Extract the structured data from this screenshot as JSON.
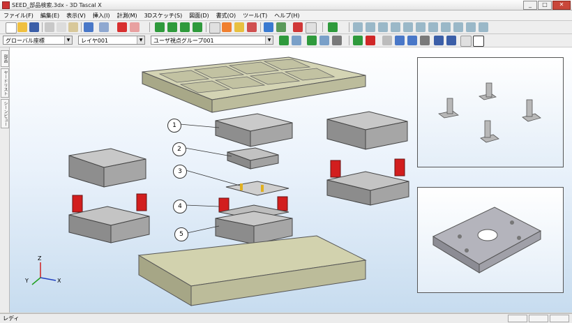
{
  "window": {
    "title": "SEED_部品検索.3dx - 3D Tascal X"
  },
  "menu": [
    "ファイル(F)",
    "編集(E)",
    "表示(V)",
    "挿入(I)",
    "計測(M)",
    "3Dスケッチ(S)",
    "図面(D)",
    "書式(O)",
    "ツール(T)",
    "ヘルプ(H)"
  ],
  "combos": {
    "coordinate": "グローバル座標",
    "layer": "レイヤ001",
    "group": "ユーザ視点グループ001"
  },
  "side_tabs": [
    "部品",
    "ヤードリスト",
    "シーンビュー"
  ],
  "callouts": [
    "1",
    "2",
    "3",
    "4",
    "5"
  ],
  "axes": {
    "z": "Z",
    "y": "Y",
    "x": "X"
  },
  "status": {
    "text": "レディ"
  },
  "colors": {
    "base_plate": "#c9c9a2",
    "die_body": "#b6b6b6",
    "spring": "#d21e1e",
    "part": "#a8a8b0"
  }
}
